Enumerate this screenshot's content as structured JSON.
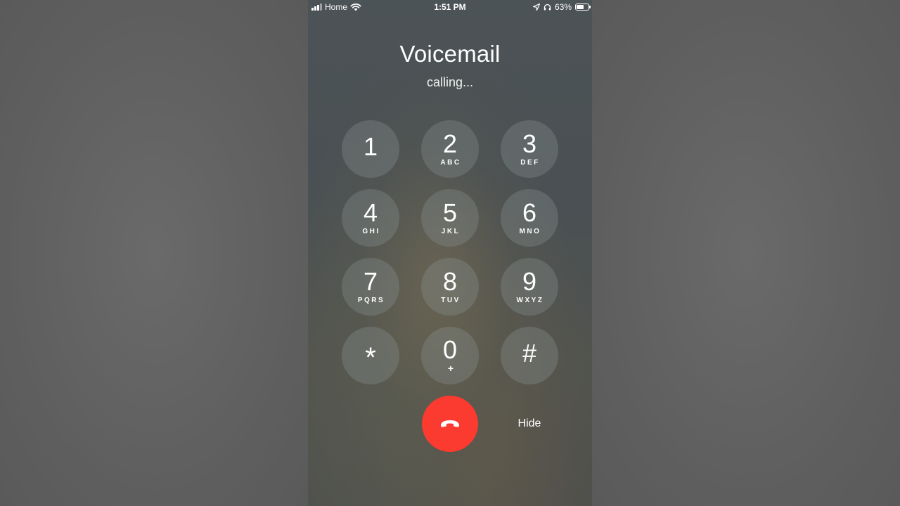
{
  "status_bar": {
    "carrier": "Home",
    "time": "1:51 PM",
    "battery_percent_text": "63%",
    "battery_level": 0.63,
    "icons": [
      "signal-icon",
      "wifi-icon",
      "location-arrow-icon",
      "headphones-icon",
      "battery-icon"
    ]
  },
  "call": {
    "title": "Voicemail",
    "status": "calling..."
  },
  "keypad": {
    "keys": [
      {
        "digit": "1",
        "letters": ""
      },
      {
        "digit": "2",
        "letters": "ABC"
      },
      {
        "digit": "3",
        "letters": "DEF"
      },
      {
        "digit": "4",
        "letters": "GHI"
      },
      {
        "digit": "5",
        "letters": "JKL"
      },
      {
        "digit": "6",
        "letters": "MNO"
      },
      {
        "digit": "7",
        "letters": "PQRS"
      },
      {
        "digit": "8",
        "letters": "TUV"
      },
      {
        "digit": "9",
        "letters": "WXYZ"
      },
      {
        "digit": "*",
        "letters": ""
      },
      {
        "digit": "0",
        "letters": "+"
      },
      {
        "digit": "#",
        "letters": ""
      }
    ]
  },
  "controls": {
    "end_call_icon": "phone-hangup-icon",
    "end_call_color": "#fb3a30",
    "hide_label": "Hide"
  }
}
